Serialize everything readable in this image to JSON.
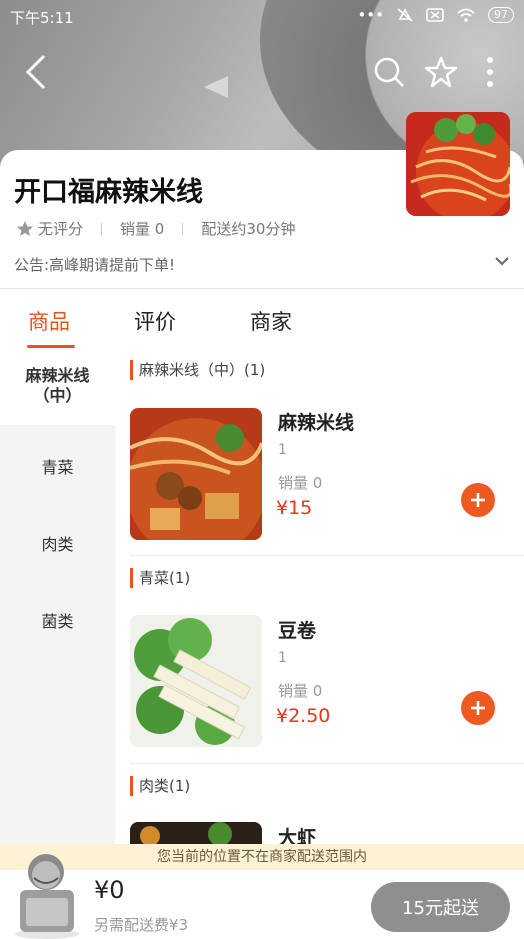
{
  "status": {
    "time": "下午5:11",
    "battery": "97"
  },
  "shop": {
    "name": "开口福麻辣米线",
    "rating": "无评分",
    "sales": "销量 0",
    "delivery": "配送约30分钟",
    "notice": "公告:高峰期请提前下单!"
  },
  "tabs": [
    "商品",
    "评价",
    "商家"
  ],
  "sidebar": [
    "麻辣米线\n（中）",
    "青菜",
    "肉类",
    "菌类"
  ],
  "sections": [
    {
      "title": "麻辣米线（中）(1)",
      "item": {
        "name": "麻辣米线",
        "qty": "1",
        "sales": "销量 0",
        "price": "¥15"
      }
    },
    {
      "title": "青菜(1)",
      "item": {
        "name": "豆卷",
        "qty": "1",
        "sales": "销量 0",
        "price": "¥2.50"
      }
    },
    {
      "title": "肉类(1)",
      "item": {
        "name": "大虾"
      }
    }
  ],
  "cart": {
    "tip": "您当前的位置不在商家配送范围内",
    "total": "¥0",
    "fee": "另需配送费¥3",
    "start_button": "15元起送"
  },
  "colors": {
    "accent": "#e8541e",
    "price": "#e8341e"
  }
}
